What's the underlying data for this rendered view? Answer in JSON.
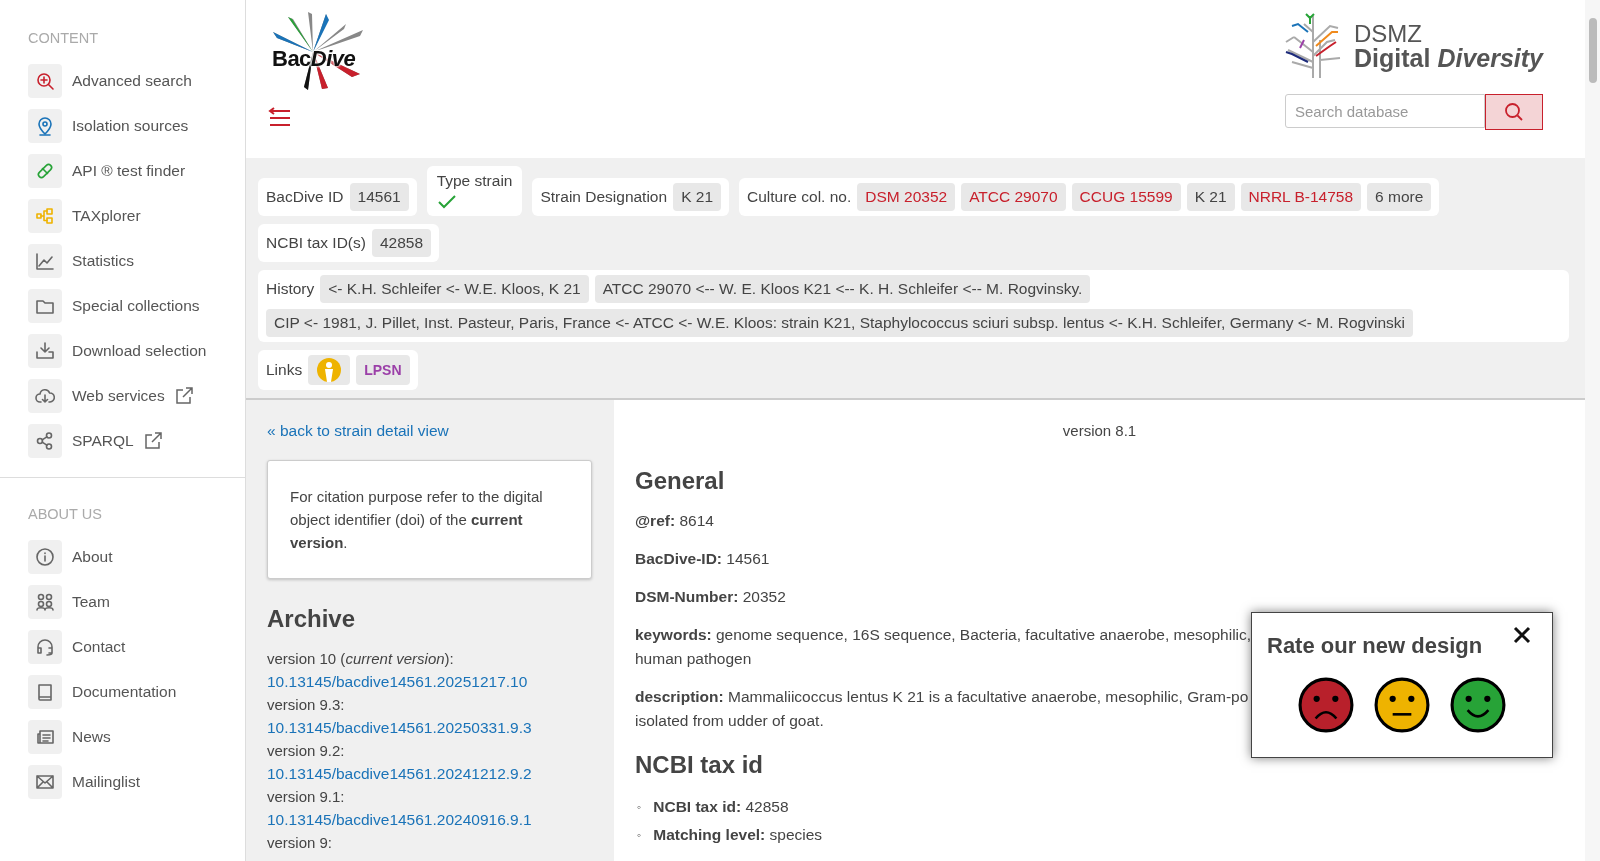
{
  "sidebar": {
    "sections": [
      {
        "title": "CONTENT",
        "items": [
          {
            "label": "Advanced search",
            "external": false
          },
          {
            "label": "Isolation sources",
            "external": false
          },
          {
            "label": "API ® test finder",
            "external": false
          },
          {
            "label": "TAXplorer",
            "external": false
          },
          {
            "label": "Statistics",
            "external": false
          },
          {
            "label": "Special collections",
            "external": false
          },
          {
            "label": "Download selection",
            "external": false
          },
          {
            "label": "Web services",
            "external": true
          },
          {
            "label": "SPARQL",
            "external": true
          }
        ]
      },
      {
        "title": "ABOUT US",
        "items": [
          {
            "label": "About",
            "external": false
          },
          {
            "label": "Team",
            "external": false
          },
          {
            "label": "Contact",
            "external": false
          },
          {
            "label": "Documentation",
            "external": false
          },
          {
            "label": "News",
            "external": false
          },
          {
            "label": "Mailinglist",
            "external": false
          }
        ]
      }
    ]
  },
  "header": {
    "logo": {
      "first": "Bac",
      "second": "Dive"
    },
    "brand_top": "DSMZ",
    "brand_bottom": "Digital *Diversity*",
    "search": {
      "placeholder": "Search database"
    }
  },
  "strain": {
    "bacdive_id": {
      "label": "BacDive ID",
      "value": "14561"
    },
    "type_strain": {
      "label": "Type strain",
      "checked": true
    },
    "designation": {
      "label": "Strain Designation",
      "value": "K 21"
    },
    "culture": {
      "label": "Culture col. no.",
      "items": [
        {
          "text": "DSM 20352",
          "link": true
        },
        {
          "text": "ATCC 29070",
          "link": true
        },
        {
          "text": "CCUG 15599",
          "link": true
        },
        {
          "text": "K 21",
          "link": false
        },
        {
          "text": "NRRL B-14758",
          "link": true
        },
        {
          "text": "6 more",
          "link": false
        }
      ]
    },
    "ncbi": {
      "label": "NCBI tax ID(s)",
      "value": "42858"
    },
    "history": {
      "label": "History",
      "items": [
        "<- K.H. Schleifer <- W.E. Kloos, K 21",
        "ATCC 29070 <-- W. E. Kloos K21 <-- K. H. Schleifer <-- M. Rogvinsky.",
        "CIP <- 1981, J. Pillet, Inst. Pasteur, Paris, France <- ATCC <- W.E. Kloos: strain K21, Staphylococcus sciuri subsp. lentus <- K.H. Schleifer, Germany <- M. Rogvinski"
      ]
    },
    "links": {
      "label": "Links",
      "items": [
        {
          "kind": "icon"
        },
        {
          "kind": "text",
          "text": "LPSN"
        }
      ]
    }
  },
  "archive_panel": {
    "back_link": "« back to strain detail view",
    "note": "For citation purpose refer to the digital object identifier (doi) of the **current version**.",
    "title": "Archive",
    "versions": [
      {
        "label": "version 10 (*current version*):",
        "doi": "10.13145/bacdive14561.20251217.10"
      },
      {
        "label": "version 9.3:",
        "doi": "10.13145/bacdive14561.20250331.9.3"
      },
      {
        "label": "version 9.2:",
        "doi": "10.13145/bacdive14561.20241212.9.2"
      },
      {
        "label": "version 9.1:",
        "doi": "10.13145/bacdive14561.20240916.9.1"
      },
      {
        "label": "version 9:"
      }
    ]
  },
  "detail": {
    "version": "version 8.1",
    "sections": [
      {
        "title": "General",
        "kind": "fields",
        "fields": [
          {
            "key": "@ref:",
            "lines": [
              "8614"
            ]
          },
          {
            "key": "BacDive-ID:",
            "lines": [
              "14561"
            ]
          },
          {
            "key": "DSM-Number:",
            "lines": [
              "20352"
            ]
          },
          {
            "key": "keywords:",
            "lines": [
              "genome sequence, 16S sequence, Bacteria, facultative anaerobe, mesophilic,",
              "human pathogen"
            ]
          },
          {
            "key": "description:",
            "lines": [
              "Mammaliicoccus lentus K 21 is a facultative anaerobe, mesophilic, Gram-po",
              "isolated from udder of goat."
            ]
          }
        ]
      },
      {
        "title": "NCBI tax id",
        "kind": "bullets",
        "fields": [
          {
            "marker": "◦",
            "key": "NCBI tax id:",
            "lines": [
              "42858"
            ]
          },
          {
            "marker": "◦",
            "key": "Matching level:",
            "lines": [
              "species"
            ]
          }
        ]
      }
    ]
  },
  "rating": {
    "title": "Rate our new design",
    "faces": [
      {
        "kind": "sad",
        "color": "#b8202b"
      },
      {
        "kind": "neutral",
        "color": "#eeb300"
      },
      {
        "kind": "happy",
        "color": "#27a337"
      }
    ]
  }
}
